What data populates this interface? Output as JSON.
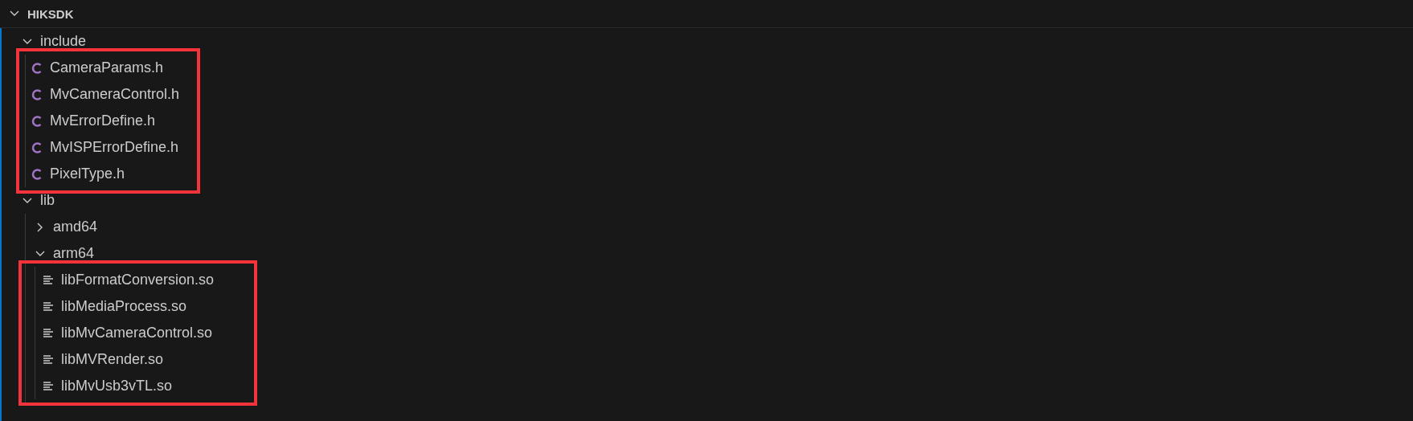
{
  "explorer": {
    "section": {
      "title": "HIKSDK",
      "expanded": true
    },
    "tree": [
      {
        "name": "include",
        "kind": "folder",
        "expanded": true,
        "annotated": true,
        "children": [
          {
            "name": "CameraParams.h",
            "kind": "c_header"
          },
          {
            "name": "MvCameraControl.h",
            "kind": "c_header"
          },
          {
            "name": "MvErrorDefine.h",
            "kind": "c_header"
          },
          {
            "name": "MvISPErrorDefine.h",
            "kind": "c_header"
          },
          {
            "name": "PixelType.h",
            "kind": "c_header"
          }
        ]
      },
      {
        "name": "lib",
        "kind": "folder",
        "expanded": true,
        "annotated": false,
        "children": [
          {
            "name": "amd64",
            "kind": "folder",
            "expanded": false
          },
          {
            "name": "arm64",
            "kind": "folder",
            "expanded": true,
            "annotated": true,
            "children": [
              {
                "name": "libFormatConversion.so",
                "kind": "binary"
              },
              {
                "name": "libMediaProcess.so",
                "kind": "binary"
              },
              {
                "name": "libMvCameraControl.so",
                "kind": "binary"
              },
              {
                "name": "libMVRender.so",
                "kind": "binary"
              },
              {
                "name": "libMvUsb3vTL.so",
                "kind": "binary"
              }
            ]
          }
        ]
      }
    ]
  }
}
